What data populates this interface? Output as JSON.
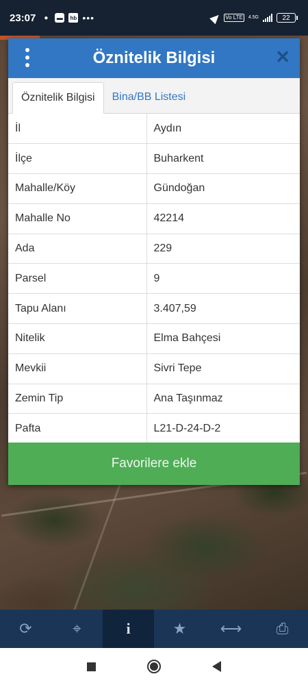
{
  "status_bar": {
    "time": "23:07",
    "net_type": "4.5G",
    "volte": "Vo LTE",
    "battery": "22"
  },
  "dialog": {
    "title": "Öznitelik Bilgisi",
    "close_glyph": "✕",
    "tabs": [
      {
        "label": "Öznitelik Bilgisi",
        "active": true
      },
      {
        "label": "Bina/BB Listesi",
        "active": false
      }
    ],
    "rows": [
      {
        "key": "İl",
        "value": "Aydın"
      },
      {
        "key": "İlçe",
        "value": "Buharkent"
      },
      {
        "key": "Mahalle/Köy",
        "value": "Gündoğan"
      },
      {
        "key": "Mahalle No",
        "value": "42214"
      },
      {
        "key": "Ada",
        "value": "229"
      },
      {
        "key": "Parsel",
        "value": "9"
      },
      {
        "key": "Tapu Alanı",
        "value": "3.407,59"
      },
      {
        "key": "Nitelik",
        "value": "Elma Bahçesi"
      },
      {
        "key": "Mevkii",
        "value": "Sivri Tepe"
      },
      {
        "key": "Zemin Tip",
        "value": "Ana Taşınmaz"
      },
      {
        "key": "Pafta",
        "value": "L21-D-24-D-2"
      }
    ],
    "favorite_button": "Favorilere ekle"
  },
  "toolbar": {
    "items": [
      {
        "icon": "refresh-icon",
        "glyph": "⟳"
      },
      {
        "icon": "locate-icon",
        "glyph": "⌖"
      },
      {
        "icon": "info-icon",
        "glyph": "i"
      },
      {
        "icon": "star-icon",
        "glyph": "★"
      },
      {
        "icon": "measure-icon",
        "glyph": "⟷"
      },
      {
        "icon": "print-icon",
        "glyph": "⎙"
      }
    ],
    "active_index": 2
  },
  "colors": {
    "header_blue": "#3177c4",
    "button_green": "#4fad56",
    "toolbar_navy": "#1a3555",
    "status_bar": "#162231"
  }
}
